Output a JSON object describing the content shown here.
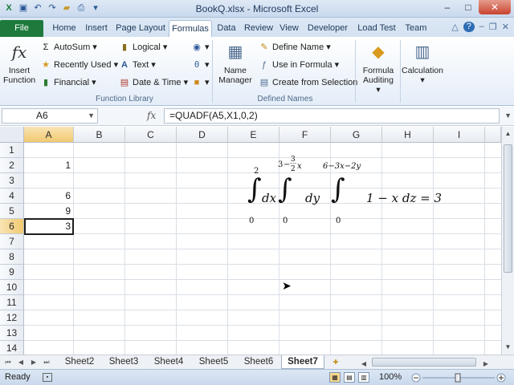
{
  "window": {
    "title": "BookQ.xlsx - Microsoft Excel",
    "controls": {
      "minimize": "–",
      "maximize": "□",
      "close": "✕"
    }
  },
  "quick_access": [
    "excel-logo-icon",
    "save-icon",
    "undo-icon",
    "redo-icon",
    "open-icon",
    "print-icon",
    "customize-dropdown-icon"
  ],
  "tabs": [
    {
      "label": "File"
    },
    {
      "label": "Home"
    },
    {
      "label": "Insert"
    },
    {
      "label": "Page Layout"
    },
    {
      "label": "Formulas"
    },
    {
      "label": "Data"
    },
    {
      "label": "Review"
    },
    {
      "label": "View"
    },
    {
      "label": "Developer"
    },
    {
      "label": "Load Test"
    },
    {
      "label": "Team"
    }
  ],
  "active_tab": "Formulas",
  "ribbon": {
    "insert_function": {
      "line1": "Insert",
      "line2": "Function"
    },
    "function_library": {
      "autosum": "AutoSum",
      "recently_used": "Recently Used",
      "financial": "Financial",
      "logical": "Logical",
      "text": "Text",
      "date_time": "Date & Time",
      "group_label": "Function Library"
    },
    "name_manager": {
      "line1": "Name",
      "line2": "Manager"
    },
    "defined_names": {
      "define_name": "Define Name",
      "use_in_formula": "Use in Formula",
      "create_from_selection": "Create from Selection",
      "group_label": "Defined Names"
    },
    "formula_auditing": {
      "line1": "Formula",
      "line2": "Auditing"
    },
    "calculation": "Calculation"
  },
  "formula_bar": {
    "name_box": "A6",
    "fx": "fx",
    "formula": "=QUADF(A5,X1,0,2)"
  },
  "columns": [
    "A",
    "B",
    "C",
    "D",
    "E",
    "F",
    "G",
    "H",
    "I"
  ],
  "rows": [
    "1",
    "2",
    "3",
    "4",
    "5",
    "6",
    "7",
    "8",
    "9",
    "10",
    "11",
    "12",
    "13",
    "14"
  ],
  "cells": {
    "A2": "1",
    "A4": "6",
    "A5": "9",
    "A6": "3"
  },
  "equation": {
    "outer_upper": "2",
    "outer_lower": "0",
    "mid_upper_3": "3",
    "mid_upper_minus": "−",
    "mid_upper_frac_num": "3",
    "mid_upper_frac_den": "2",
    "mid_upper_x": "x",
    "mid_lower": "0",
    "inner_upper": "6−3x−2y",
    "inner_lower": "0",
    "dx": "dx",
    "dy": "dy",
    "integrand": "1 − x  dz = 3"
  },
  "sheets": [
    "Sheet2",
    "Sheet3",
    "Sheet4",
    "Sheet5",
    "Sheet6",
    "Sheet7"
  ],
  "active_sheet": "Sheet7",
  "status": {
    "ready": "Ready",
    "zoom": "100%"
  }
}
